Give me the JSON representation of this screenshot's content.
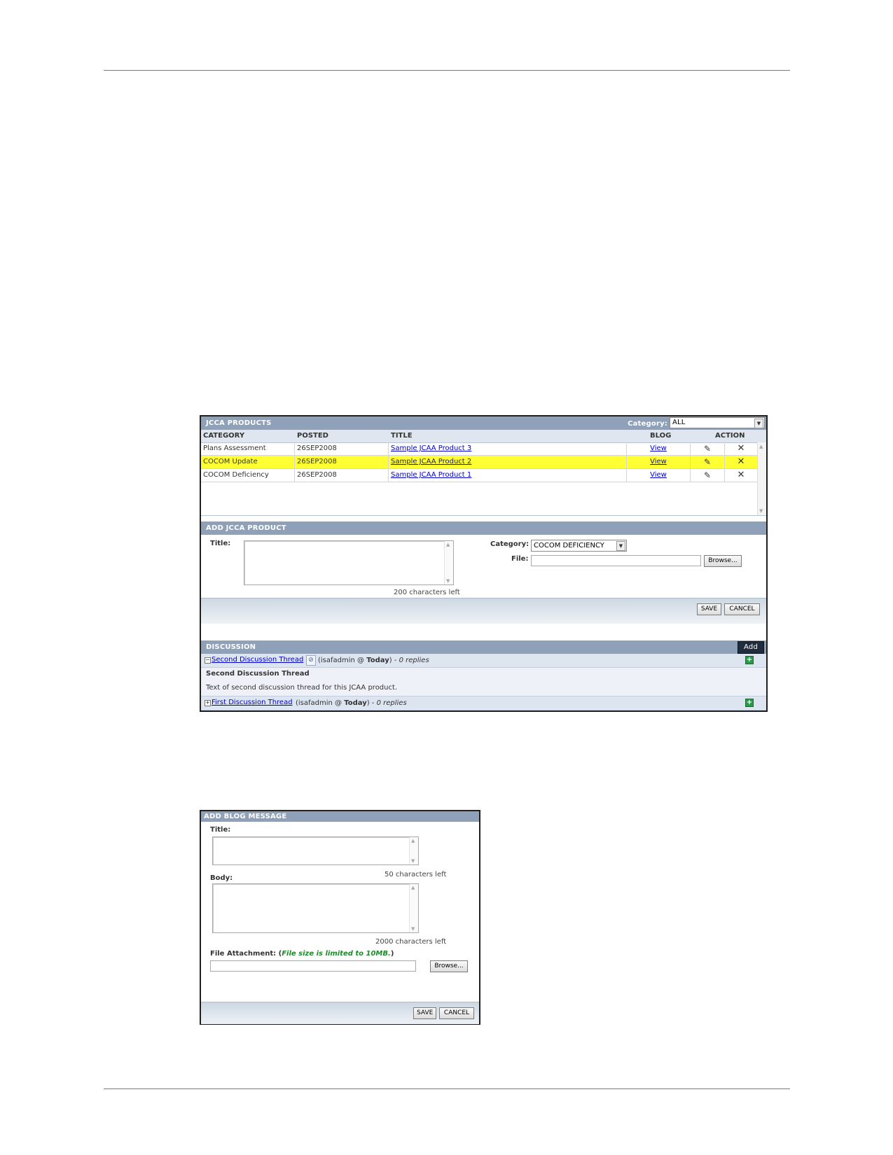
{
  "products": {
    "header": "JCCA PRODUCTS",
    "category_filter_label": "Category:",
    "category_filter_value": "ALL",
    "columns": [
      "CATEGORY",
      "POSTED",
      "TITLE",
      "BLOG",
      "ACTION"
    ],
    "rows": [
      {
        "category": "Plans Assessment",
        "posted": "26SEP2008",
        "title": "Sample JCAA Product 3",
        "blog": "View",
        "selected": false
      },
      {
        "category": "COCOM Update",
        "posted": "26SEP2008",
        "title": "Sample JCAA Product 2",
        "blog": "View",
        "selected": true
      },
      {
        "category": "COCOM Deficiency",
        "posted": "26SEP2008",
        "title": "Sample JCAA Product 1",
        "blog": "View",
        "selected": false
      }
    ]
  },
  "add_product": {
    "header": "ADD JCCA PRODUCT",
    "title_label": "Title:",
    "title_counter": "200 characters left",
    "category_label": "Category:",
    "category_value": "COCOM DEFICIENCY",
    "file_label": "File:",
    "browse_label": "Browse...",
    "save_label": "SAVE",
    "cancel_label": "CANCEL"
  },
  "discussion": {
    "header": "DISCUSSION",
    "add_label": "Add",
    "threads": [
      {
        "title": "Second Discussion Thread",
        "author": "(isafadmin @ ",
        "when": "Today",
        "close": ")",
        "replies": " - 0 replies",
        "expanded": true,
        "body_title": "Second Discussion Thread",
        "body_text": "Text of second discussion thread for this JCAA product."
      },
      {
        "title": "First Discussion Thread",
        "author": "(isafadmin @ ",
        "when": "Today",
        "close": ")",
        "replies": " - 0 replies",
        "expanded": false
      }
    ]
  },
  "blog": {
    "header": "ADD BLOG MESSAGE",
    "title_label": "Title:",
    "title_counter": "50 characters left",
    "body_label": "Body:",
    "body_counter": "2000 characters left",
    "attachment_label": "File Attachment: (",
    "attachment_note": "File size is limited to 10MB.",
    "attachment_close": ")",
    "browse_label": "Browse...",
    "save_label": "SAVE",
    "cancel_label": "CANCEL"
  },
  "colors": {
    "header": "#8fa1b8",
    "selected_row": "#ffff33",
    "link": "#0000cc",
    "size_note": "#1f8a2a"
  }
}
